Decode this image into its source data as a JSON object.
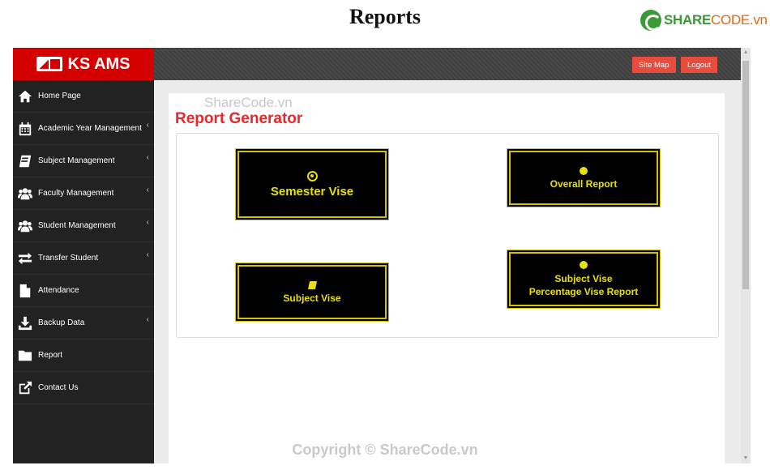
{
  "page": {
    "heading": "Reports"
  },
  "logo": {
    "part1": "SHARE",
    "part2": "CODE.vn"
  },
  "app": {
    "brand": "KS AMS",
    "top_buttons": {
      "sitemap": "Site Map",
      "logout": "Logout"
    },
    "sidebar": {
      "items": [
        {
          "label": "Home Page",
          "icon": "home-icon",
          "chevron": false
        },
        {
          "label": "Academic Year Management",
          "icon": "calendar-icon",
          "chevron": true
        },
        {
          "label": "Subject Management",
          "icon": "book-icon",
          "chevron": true
        },
        {
          "label": "Faculty Management",
          "icon": "users-icon",
          "chevron": true
        },
        {
          "label": "Student Management",
          "icon": "users-icon",
          "chevron": true
        },
        {
          "label": "Transfer Student",
          "icon": "exchange-icon",
          "chevron": true
        },
        {
          "label": "Attendance",
          "icon": "file-icon",
          "chevron": false
        },
        {
          "label": "Backup Data",
          "icon": "download-icon",
          "chevron": true
        },
        {
          "label": "Report",
          "icon": "folder-icon",
          "chevron": false
        },
        {
          "label": "Contact Us",
          "icon": "external-link-icon",
          "chevron": false
        }
      ],
      "chevron_glyph": "‹"
    },
    "content": {
      "title": "Report Generator",
      "buttons": {
        "semester": "Semester Vise",
        "overall": "Overall Report",
        "subject": "Subject Vise",
        "subject_pct_line1": "Subject Vise",
        "subject_pct_line2": "Percentage Vise Report"
      }
    }
  },
  "watermark": {
    "top": "ShareCode.vn",
    "bottom": "Copyright © ShareCode.vn"
  },
  "colors": {
    "brand_red": "#d40000",
    "title_red": "#e8282b",
    "button_yellow": "#e8e000",
    "sidebar_bg": "#222222",
    "top_button": "#e74c3c"
  }
}
